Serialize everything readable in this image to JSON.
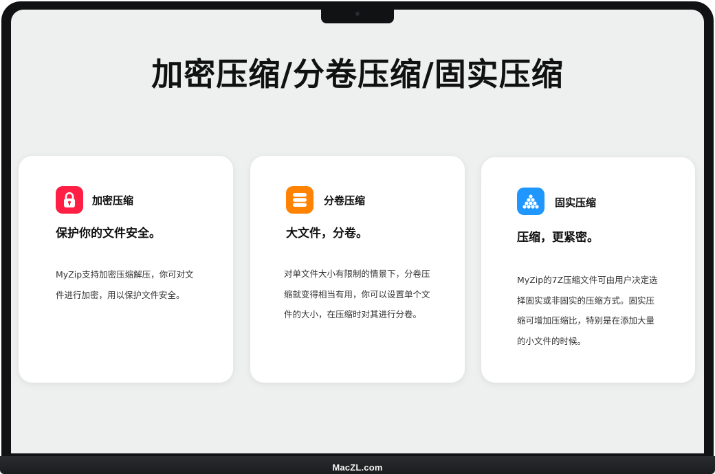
{
  "page": {
    "headline": "加密压缩/分卷压缩/固实压缩",
    "brand": "MacZL.com"
  },
  "cards": [
    {
      "icon": "padlock-icon",
      "icon_color": "#ff1f44",
      "name": "加密压缩",
      "tagline": "保护你的文件安全。",
      "description": "MyZip支持加密压缩解压，你可对文件进行加密，用以保护文件安全。"
    },
    {
      "icon": "stacked-volumes-icon",
      "icon_color": "#ff8200",
      "name": "分卷压缩",
      "tagline": "大文件，分卷。",
      "description": "对单文件大小有限制的情景下，分卷压缩就变得相当有用，你可以设置单个文件的大小，在压缩时对其进行分卷。"
    },
    {
      "icon": "pyramid-balls-icon",
      "icon_color": "#1f97ff",
      "name": "固实压缩",
      "tagline": "压缩，更紧密。",
      "description": "MyZip的7Z压缩文件可由用户决定选择固实或非固实的压缩方式。固实压缩可增加压缩比，特别是在添加大量的小文件的时候。"
    }
  ]
}
